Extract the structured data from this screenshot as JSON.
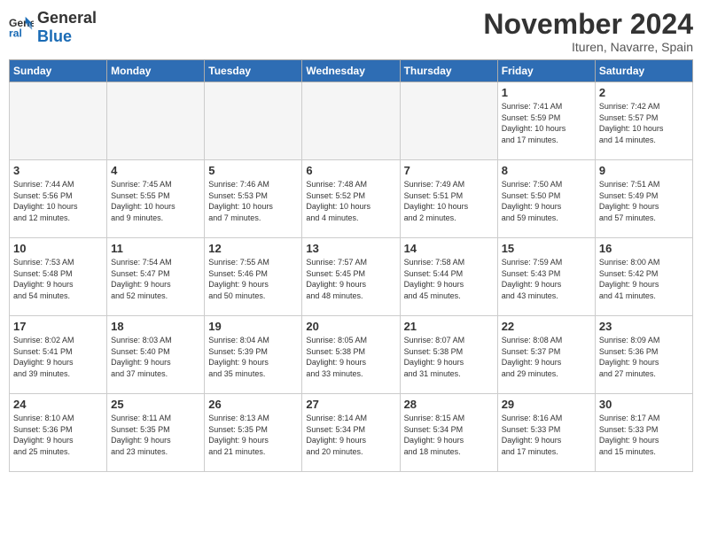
{
  "header": {
    "logo_general": "General",
    "logo_blue": "Blue",
    "month_title": "November 2024",
    "location": "Ituren, Navarre, Spain"
  },
  "calendar": {
    "days_of_week": [
      "Sunday",
      "Monday",
      "Tuesday",
      "Wednesday",
      "Thursday",
      "Friday",
      "Saturday"
    ],
    "weeks": [
      [
        {
          "day": "",
          "info": ""
        },
        {
          "day": "",
          "info": ""
        },
        {
          "day": "",
          "info": ""
        },
        {
          "day": "",
          "info": ""
        },
        {
          "day": "",
          "info": ""
        },
        {
          "day": "1",
          "info": "Sunrise: 7:41 AM\nSunset: 5:59 PM\nDaylight: 10 hours\nand 17 minutes."
        },
        {
          "day": "2",
          "info": "Sunrise: 7:42 AM\nSunset: 5:57 PM\nDaylight: 10 hours\nand 14 minutes."
        }
      ],
      [
        {
          "day": "3",
          "info": "Sunrise: 7:44 AM\nSunset: 5:56 PM\nDaylight: 10 hours\nand 12 minutes."
        },
        {
          "day": "4",
          "info": "Sunrise: 7:45 AM\nSunset: 5:55 PM\nDaylight: 10 hours\nand 9 minutes."
        },
        {
          "day": "5",
          "info": "Sunrise: 7:46 AM\nSunset: 5:53 PM\nDaylight: 10 hours\nand 7 minutes."
        },
        {
          "day": "6",
          "info": "Sunrise: 7:48 AM\nSunset: 5:52 PM\nDaylight: 10 hours\nand 4 minutes."
        },
        {
          "day": "7",
          "info": "Sunrise: 7:49 AM\nSunset: 5:51 PM\nDaylight: 10 hours\nand 2 minutes."
        },
        {
          "day": "8",
          "info": "Sunrise: 7:50 AM\nSunset: 5:50 PM\nDaylight: 9 hours\nand 59 minutes."
        },
        {
          "day": "9",
          "info": "Sunrise: 7:51 AM\nSunset: 5:49 PM\nDaylight: 9 hours\nand 57 minutes."
        }
      ],
      [
        {
          "day": "10",
          "info": "Sunrise: 7:53 AM\nSunset: 5:48 PM\nDaylight: 9 hours\nand 54 minutes."
        },
        {
          "day": "11",
          "info": "Sunrise: 7:54 AM\nSunset: 5:47 PM\nDaylight: 9 hours\nand 52 minutes."
        },
        {
          "day": "12",
          "info": "Sunrise: 7:55 AM\nSunset: 5:46 PM\nDaylight: 9 hours\nand 50 minutes."
        },
        {
          "day": "13",
          "info": "Sunrise: 7:57 AM\nSunset: 5:45 PM\nDaylight: 9 hours\nand 48 minutes."
        },
        {
          "day": "14",
          "info": "Sunrise: 7:58 AM\nSunset: 5:44 PM\nDaylight: 9 hours\nand 45 minutes."
        },
        {
          "day": "15",
          "info": "Sunrise: 7:59 AM\nSunset: 5:43 PM\nDaylight: 9 hours\nand 43 minutes."
        },
        {
          "day": "16",
          "info": "Sunrise: 8:00 AM\nSunset: 5:42 PM\nDaylight: 9 hours\nand 41 minutes."
        }
      ],
      [
        {
          "day": "17",
          "info": "Sunrise: 8:02 AM\nSunset: 5:41 PM\nDaylight: 9 hours\nand 39 minutes."
        },
        {
          "day": "18",
          "info": "Sunrise: 8:03 AM\nSunset: 5:40 PM\nDaylight: 9 hours\nand 37 minutes."
        },
        {
          "day": "19",
          "info": "Sunrise: 8:04 AM\nSunset: 5:39 PM\nDaylight: 9 hours\nand 35 minutes."
        },
        {
          "day": "20",
          "info": "Sunrise: 8:05 AM\nSunset: 5:38 PM\nDaylight: 9 hours\nand 33 minutes."
        },
        {
          "day": "21",
          "info": "Sunrise: 8:07 AM\nSunset: 5:38 PM\nDaylight: 9 hours\nand 31 minutes."
        },
        {
          "day": "22",
          "info": "Sunrise: 8:08 AM\nSunset: 5:37 PM\nDaylight: 9 hours\nand 29 minutes."
        },
        {
          "day": "23",
          "info": "Sunrise: 8:09 AM\nSunset: 5:36 PM\nDaylight: 9 hours\nand 27 minutes."
        }
      ],
      [
        {
          "day": "24",
          "info": "Sunrise: 8:10 AM\nSunset: 5:36 PM\nDaylight: 9 hours\nand 25 minutes."
        },
        {
          "day": "25",
          "info": "Sunrise: 8:11 AM\nSunset: 5:35 PM\nDaylight: 9 hours\nand 23 minutes."
        },
        {
          "day": "26",
          "info": "Sunrise: 8:13 AM\nSunset: 5:35 PM\nDaylight: 9 hours\nand 21 minutes."
        },
        {
          "day": "27",
          "info": "Sunrise: 8:14 AM\nSunset: 5:34 PM\nDaylight: 9 hours\nand 20 minutes."
        },
        {
          "day": "28",
          "info": "Sunrise: 8:15 AM\nSunset: 5:34 PM\nDaylight: 9 hours\nand 18 minutes."
        },
        {
          "day": "29",
          "info": "Sunrise: 8:16 AM\nSunset: 5:33 PM\nDaylight: 9 hours\nand 17 minutes."
        },
        {
          "day": "30",
          "info": "Sunrise: 8:17 AM\nSunset: 5:33 PM\nDaylight: 9 hours\nand 15 minutes."
        }
      ]
    ]
  }
}
